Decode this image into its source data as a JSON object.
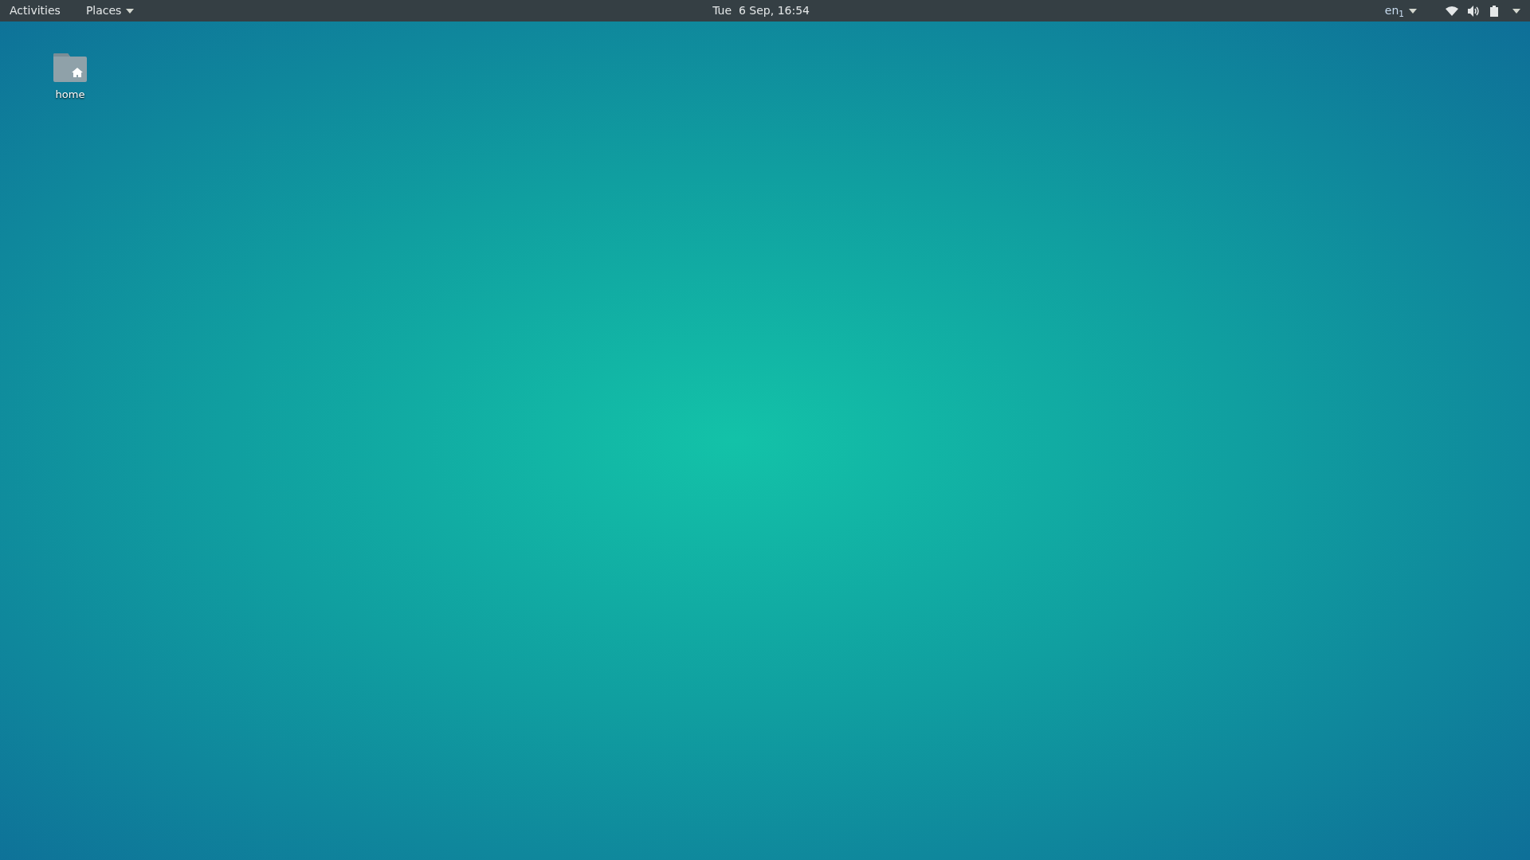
{
  "top_bar": {
    "activities": "Activities",
    "places": "Places",
    "clock": "Tue  6 Sep, 16:54",
    "input_source": "en$_{1}$"
  },
  "desktop_icons": [
    {
      "label": "home"
    }
  ]
}
